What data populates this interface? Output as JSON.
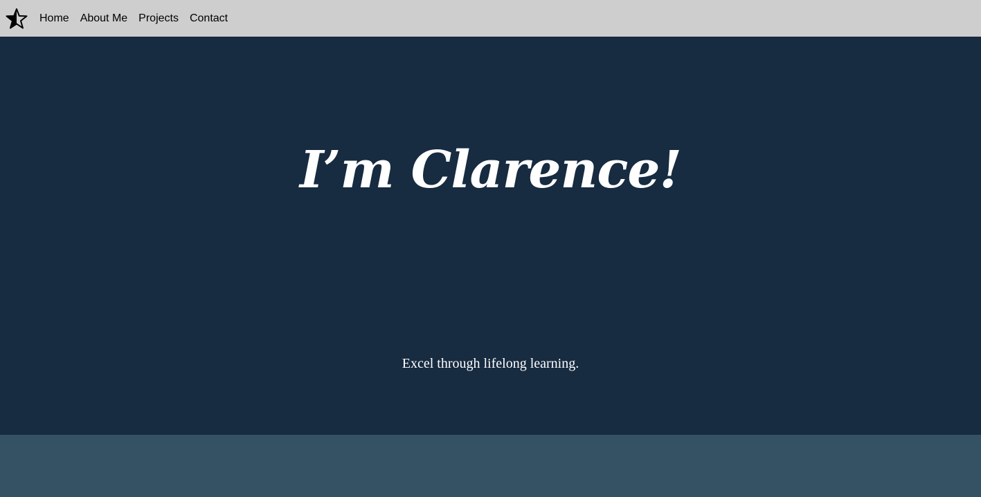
{
  "nav": {
    "logo_icon": "star-half-filled-icon",
    "links": [
      "Home",
      "About Me",
      "Projects",
      "Contact"
    ]
  },
  "hero": {
    "title": "I’m Clarence!",
    "tagline": "Excel through lifelong learning."
  },
  "colors": {
    "navbar_bg": "#cecece",
    "hero_bg": "#172b41",
    "next_section_bg": "#355265",
    "hero_text": "#ffffff"
  }
}
